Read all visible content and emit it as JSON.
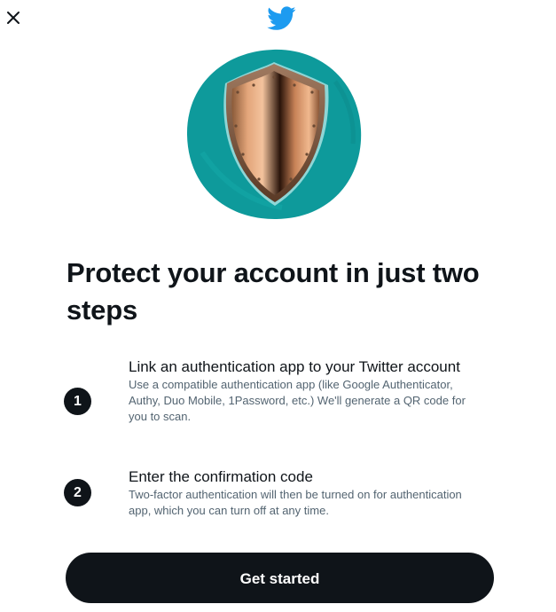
{
  "icons": {
    "close": "close-icon",
    "logo": "twitter-bird-icon",
    "illustration": "shield-icon"
  },
  "colors": {
    "brand_blue": "#1d9bf0",
    "teal_circle": "#0e9a9b",
    "text_primary": "#0f1419",
    "text_secondary": "#536471",
    "button_bg": "#0f1419",
    "button_text": "#ffffff"
  },
  "headline": "Protect your account in just two steps",
  "steps": [
    {
      "number": "1",
      "title": "Link an authentication app to your Twitter account",
      "description": "Use a compatible authentication app (like Google Authenticator, Authy, Duo Mobile, 1Password, etc.) We'll generate a QR code for you to scan."
    },
    {
      "number": "2",
      "title": "Enter the confirmation code",
      "description": "Two-factor authentication will then be turned on for authentication app, which you can turn off at any time."
    }
  ],
  "primary_button": {
    "label": "Get started"
  }
}
